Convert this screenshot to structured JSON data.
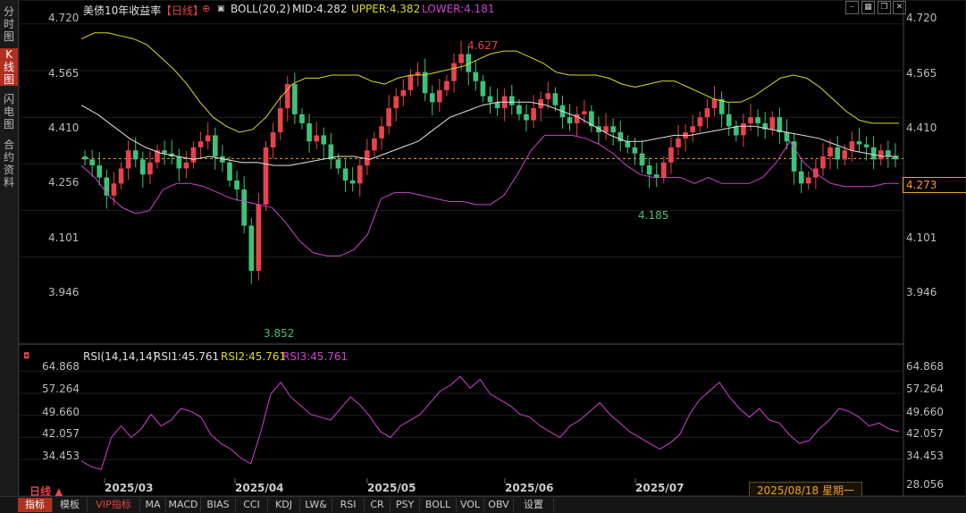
{
  "sidebar": {
    "tabs": [
      {
        "label": "分\n时\n图"
      },
      {
        "label": "K\n线\n图"
      },
      {
        "label": "闪\n电\n图"
      },
      {
        "label": "合\n约\n资\n料"
      }
    ]
  },
  "header": {
    "title": "美债10年收益率",
    "period_tag": "【日线】",
    "boll_label": "BOLL(20,2)",
    "mid": "MID:4.282",
    "upper": "UPPER:4.382",
    "lower": "LOWER:4.181"
  },
  "rsi_header": {
    "label": "RSI(14,14,14)",
    "rsi1": "RSI1:45.761",
    "rsi2": "RSI2:45.761",
    "rsi3": "RSI3:45.761"
  },
  "price_axis": [
    "4.720",
    "4.565",
    "4.410",
    "4.256",
    "4.101",
    "3.946"
  ],
  "rsi_axis": [
    "64.868",
    "57.264",
    "49.660",
    "42.057",
    "34.453"
  ],
  "current_price": "4.273",
  "rsi_bottom_value": "28.056",
  "annotations": {
    "high": "4.627",
    "low": "3.852",
    "mid_low": "4.185"
  },
  "x_labels": [
    "2025/03",
    "2025/04",
    "2025/05",
    "2025/06",
    "2025/07"
  ],
  "cursor_date": "2025/08/18 星期一",
  "period_indicator": "日线",
  "bottom_tabs": [
    "指标",
    "模板",
    "VIP指标",
    "MA",
    "MACD",
    "BIAS",
    "CCI",
    "KDJ",
    "LW&",
    "RSI",
    "CR",
    "PSY",
    "BOLL",
    "VOL",
    "OBV",
    "设置"
  ],
  "colors": {
    "up": "#e8424a",
    "down": "#3ec27a",
    "upper": "#d9d92a",
    "mid": "#e0e0e0",
    "lower": "#d040d0",
    "rsi": "#d040d0",
    "price_line": "#f0a020"
  },
  "chart_data": {
    "type": "candlestick",
    "ylim": [
      3.82,
      4.74
    ],
    "closes": [
      4.27,
      4.25,
      4.21,
      4.15,
      4.19,
      4.24,
      4.3,
      4.27,
      4.22,
      4.26,
      4.3,
      4.29,
      4.28,
      4.24,
      4.26,
      4.31,
      4.33,
      4.35,
      4.28,
      4.26,
      4.2,
      4.17,
      4.05,
      3.9,
      4.12,
      4.31,
      4.36,
      4.44,
      4.52,
      4.42,
      4.39,
      4.33,
      4.35,
      4.32,
      4.27,
      4.24,
      4.2,
      4.19,
      4.25,
      4.3,
      4.34,
      4.38,
      4.44,
      4.48,
      4.5,
      4.55,
      4.56,
      4.49,
      4.46,
      4.5,
      4.53,
      4.59,
      4.62,
      4.56,
      4.53,
      4.48,
      4.46,
      4.44,
      4.48,
      4.45,
      4.42,
      4.4,
      4.44,
      4.47,
      4.49,
      4.45,
      4.41,
      4.39,
      4.42,
      4.43,
      4.38,
      4.36,
      4.38,
      4.36,
      4.33,
      4.31,
      4.29,
      4.25,
      4.22,
      4.21,
      4.26,
      4.31,
      4.34,
      4.36,
      4.38,
      4.41,
      4.44,
      4.47,
      4.42,
      4.38,
      4.35,
      4.39,
      4.41,
      4.39,
      4.37,
      4.41,
      4.36,
      4.33,
      4.23,
      4.19,
      4.21,
      4.24,
      4.28,
      4.31,
      4.27,
      4.3,
      4.33,
      4.32,
      4.31,
      4.27,
      4.3,
      4.28,
      4.27
    ],
    "upper": [
      4.67,
      4.69,
      4.69,
      4.68,
      4.67,
      4.65,
      4.61,
      4.57,
      4.52,
      4.46,
      4.41,
      4.38,
      4.36,
      4.37,
      4.41,
      4.47,
      4.52,
      4.54,
      4.54,
      4.55,
      4.55,
      4.55,
      4.53,
      4.52,
      4.54,
      4.55,
      4.55,
      4.56,
      4.57,
      4.58,
      4.6,
      4.62,
      4.63,
      4.63,
      4.61,
      4.59,
      4.56,
      4.55,
      4.55,
      4.55,
      4.54,
      4.52,
      4.51,
      4.52,
      4.53,
      4.53,
      4.51,
      4.49,
      4.47,
      4.46,
      4.46,
      4.48,
      4.51,
      4.54,
      4.55,
      4.54,
      4.51,
      4.47,
      4.43,
      4.4,
      4.39,
      4.39,
      4.39
    ],
    "mid": [
      4.45,
      4.42,
      4.38,
      4.34,
      4.31,
      4.29,
      4.28,
      4.27,
      4.28,
      4.27,
      4.26,
      4.26,
      4.25,
      4.25,
      4.26,
      4.27,
      4.28,
      4.28,
      4.27,
      4.29,
      4.31,
      4.33,
      4.37,
      4.41,
      4.43,
      4.45,
      4.46,
      4.46,
      4.46,
      4.45,
      4.43,
      4.41,
      4.38,
      4.35,
      4.33,
      4.33,
      4.34,
      4.35,
      4.35,
      4.36,
      4.37,
      4.38,
      4.38,
      4.37,
      4.36,
      4.35,
      4.34,
      4.32,
      4.3,
      4.29,
      4.28,
      4.28
    ],
    "lower": [
      4.25,
      4.21,
      4.15,
      4.11,
      4.09,
      4.1,
      4.17,
      4.19,
      4.19,
      4.18,
      4.16,
      4.14,
      4.13,
      4.12,
      4.11,
      4.06,
      4.0,
      3.96,
      3.95,
      3.95,
      3.97,
      4.02,
      4.14,
      4.16,
      4.16,
      4.15,
      4.14,
      4.13,
      4.13,
      4.12,
      4.12,
      4.15,
      4.22,
      4.3,
      4.35,
      4.35,
      4.35,
      4.34,
      4.32,
      4.29,
      4.25,
      4.22,
      4.21,
      4.21,
      4.21,
      4.19,
      4.21,
      4.19,
      4.19,
      4.19,
      4.21,
      4.26,
      4.33,
      4.26,
      4.22,
      4.19,
      4.18,
      4.18,
      4.18,
      4.19,
      4.19
    ],
    "rsi": [
      34,
      32,
      31,
      42,
      46,
      42,
      45,
      50,
      46,
      48,
      52,
      51,
      49,
      43,
      40,
      38,
      35,
      33,
      44,
      57,
      61,
      56,
      53,
      50,
      49,
      48,
      52,
      56,
      53,
      49,
      44,
      42,
      46,
      48,
      50,
      54,
      58,
      60,
      63,
      59,
      62,
      57,
      55,
      53,
      50,
      49,
      46,
      44,
      42,
      46,
      48,
      51,
      54,
      50,
      47,
      44,
      42,
      40,
      38,
      40,
      43,
      50,
      55,
      58,
      61,
      56,
      52,
      49,
      52,
      48,
      47,
      43,
      40,
      41,
      45,
      48,
      52,
      51,
      49,
      46,
      47,
      45,
      44
    ],
    "x_labels": [
      "2025/03",
      "2025/04",
      "2025/05",
      "2025/06",
      "2025/07"
    ],
    "rsi_ylim": [
      28.056,
      68.0
    ]
  }
}
